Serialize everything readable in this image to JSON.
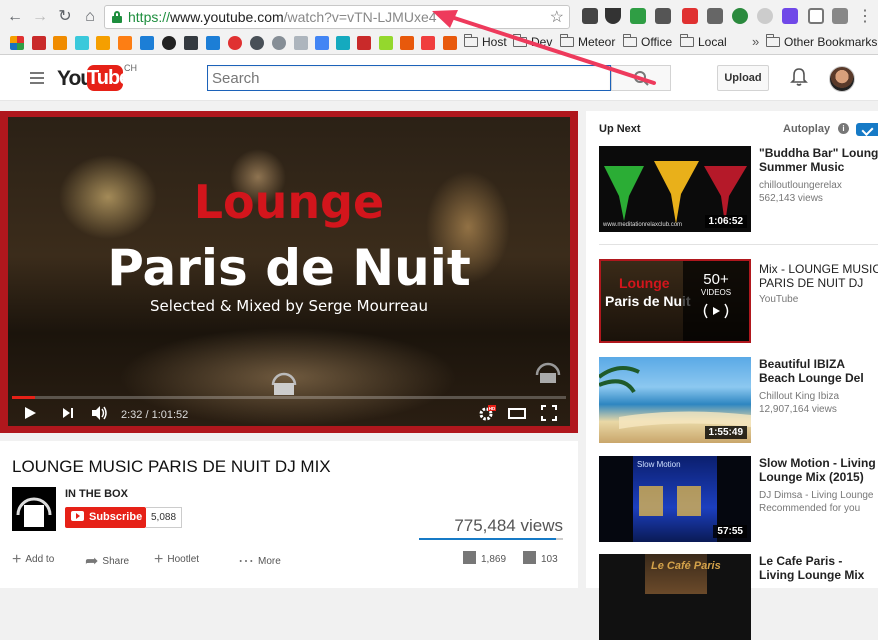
{
  "browser": {
    "url_scheme": "https://",
    "url_host": "www.youtube.com",
    "url_path": "/watch?v=vTN-LJMUxe4",
    "bookmarks": {
      "folders": [
        "Host",
        "Dev",
        "Meteor",
        "Office",
        "Local"
      ],
      "more_label": "»",
      "other_label": "Other Bookmarks"
    }
  },
  "header": {
    "logo_you": "You",
    "logo_tube": "Tube",
    "region": "CH",
    "search_placeholder": "Search",
    "upload_label": "Upload"
  },
  "player": {
    "overlay_line1": "Lounge",
    "overlay_line2": "Paris de Nuit",
    "overlay_line3": "Selected & Mixed by Serge Mourreau",
    "time_display": "2:32 / 1:01:52",
    "progress_fraction": 0.041,
    "hd_badge": "HD"
  },
  "video": {
    "title": "LOUNGE MUSIC PARIS DE NUIT DJ MIX",
    "channel": "IN THE BOX",
    "subscribe_label": "Subscribe",
    "subscriber_count": "5,088",
    "views": "775,484 views",
    "like_ratio": 0.948,
    "actions": {
      "add_to": "Add to",
      "share": "Share",
      "hootlet": "Hootlet",
      "more": "More"
    },
    "likes": "1,869",
    "dislikes": "103"
  },
  "sidebar": {
    "up_next_label": "Up Next",
    "autoplay_label": "Autoplay",
    "autoplay_on": true,
    "items": [
      {
        "title_line1": "\"Buddha Bar\" Lounge",
        "title_line2": "Summer Music",
        "channel": "chilloutloungerelax",
        "views": "562,143 views",
        "duration": "1:06:52",
        "thumb_caption": "www.meditationrelaxclub.com"
      },
      {
        "title_line1": "Mix - LOUNGE MUSIC",
        "title_line2": "PARIS DE NUIT DJ",
        "channel": "YouTube",
        "playlist_count": "50+",
        "playlist_label": "VIDEOS",
        "thumb_line1": "Lounge",
        "thumb_line2": "Paris de Nuit"
      },
      {
        "title_line1": "Beautiful IBIZA",
        "title_line2": "Beach Lounge Del",
        "channel": "Chillout King Ibiza",
        "views": "12,907,164 views",
        "duration": "1:55:49"
      },
      {
        "title_line1": "Slow Motion - Living",
        "title_line2": "Lounge Mix (2015)",
        "channel": "DJ Dimsa - Living Lounge",
        "extra": "Recommended for you",
        "duration": "57:55",
        "thumb_caption": "Slow Motion"
      },
      {
        "title_line1": "Le Cafe Paris -",
        "title_line2": "Living Lounge Mix",
        "thumb_caption": "Le Café Paris"
      }
    ]
  },
  "colors": {
    "youtube_red": "#e62117",
    "link_blue": "#167ac6",
    "secure_green": "#1e8e3e",
    "annotation_arrow": "#ee3a5c"
  }
}
